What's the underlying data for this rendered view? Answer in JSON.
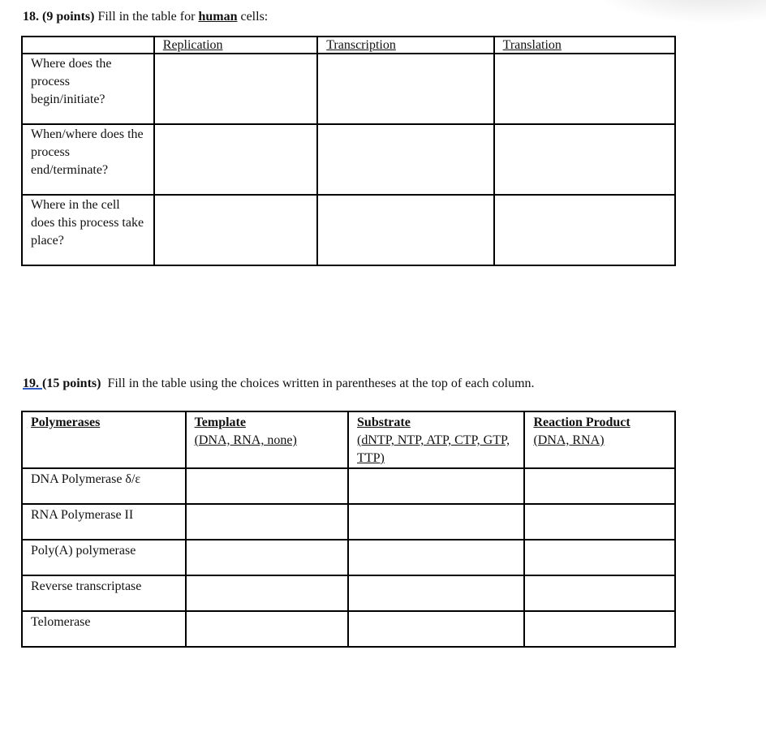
{
  "question18": {
    "number": "18.",
    "points": "(9 points)",
    "text_before": " Fill in the table for ",
    "emphasis": "human",
    "text_after": " cells:",
    "table": {
      "columns": [
        "",
        "Replication",
        "Transcription",
        "Translation"
      ],
      "rows": [
        {
          "label": "Where does the process begin/initiate?",
          "cells": [
            "",
            "",
            ""
          ]
        },
        {
          "label": "When/where does the process end/terminate?",
          "cells": [
            "",
            "",
            ""
          ]
        },
        {
          "label": "Where in the cell does this process take place?",
          "cells": [
            "",
            "",
            ""
          ]
        }
      ]
    }
  },
  "question19": {
    "number": "19. ",
    "points": "(15 points)",
    "text": "  Fill in the table using the choices written in parentheses at the top of each column.",
    "table": {
      "columns": [
        {
          "heading": "Polymerases",
          "options": ""
        },
        {
          "heading": "Template",
          "options": "(DNA, RNA, none)"
        },
        {
          "heading": "Substrate",
          "options": "(dNTP, NTP, ATP, CTP, GTP, TTP)"
        },
        {
          "heading": "Reaction Product",
          "options": "(DNA, RNA)"
        }
      ],
      "rows": [
        {
          "label": "DNA Polymerase δ/ε",
          "cells": [
            "",
            "",
            ""
          ]
        },
        {
          "label": "RNA Polymerase II",
          "cells": [
            "",
            "",
            ""
          ]
        },
        {
          "label": "Poly(A) polymerase",
          "cells": [
            "",
            "",
            ""
          ]
        },
        {
          "label": "Reverse transcriptase",
          "cells": [
            "",
            "",
            ""
          ]
        },
        {
          "label": "Telomerase",
          "cells": [
            "",
            "",
            ""
          ]
        }
      ]
    }
  }
}
